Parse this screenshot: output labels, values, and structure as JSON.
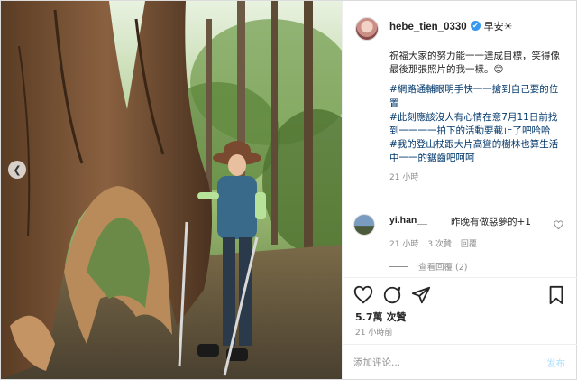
{
  "header": {
    "username": "hebe_tien_0330",
    "verified_mark": "✔",
    "greeting": "早安☀"
  },
  "caption": {
    "line1": "祝福大家的努力能一一達成目標，笑得像最後那張照片的我一樣。😊",
    "tag1": "#網路通輔眼明手快一一搶到自己要的位置",
    "tag2": "#此刻應該沒人有心情在意7月11日前找到一一一一拍下的活動要截止了吧哈哈",
    "tag3": "#我的登山杖跟大片高聳的樹林也算生活中一一的鋸齒吧呵呵",
    "time": "21 小時"
  },
  "comment": {
    "username": "yi.han__",
    "text": "昨晚有做惡夢的+1",
    "time": "21 小時",
    "likes": "3 次贊",
    "reply": "回覆",
    "view_replies": "查看回覆 (2)"
  },
  "stats": {
    "likes": "5.7萬 次贊",
    "time": "21 小時前"
  },
  "add_comment": {
    "placeholder": "添加评论...",
    "post_label": "发布"
  },
  "photo": {
    "prev_icon": "chevron-left-icon"
  }
}
